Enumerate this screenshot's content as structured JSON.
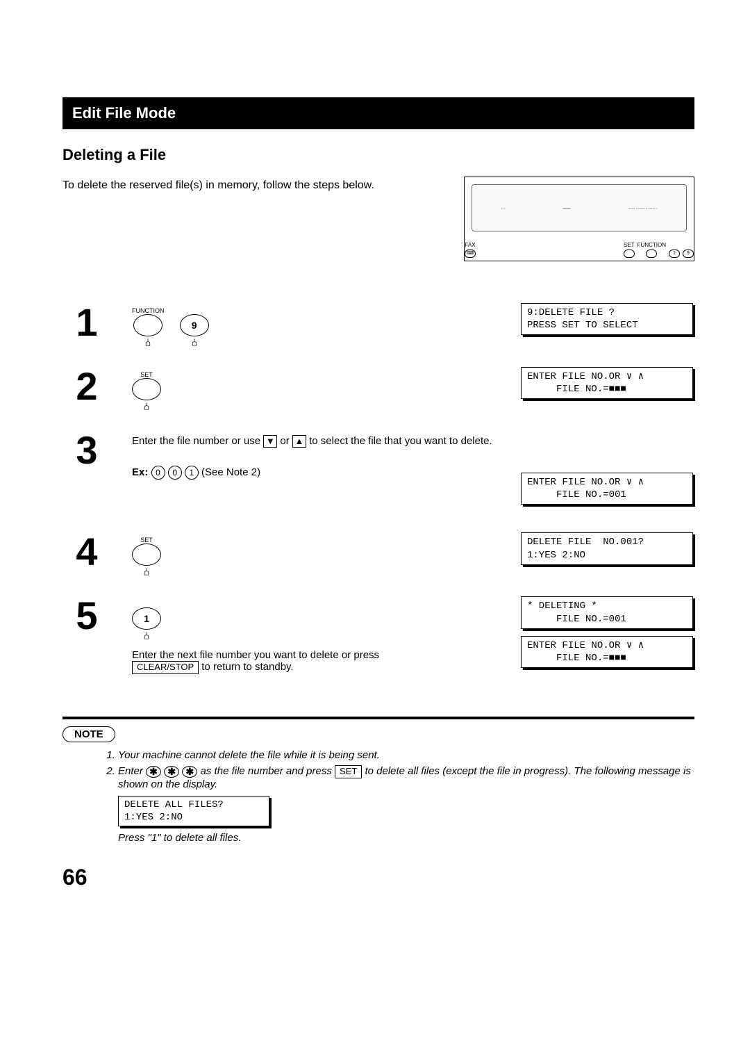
{
  "title_bar": "Edit File Mode",
  "sub_title": "Deleting a File",
  "intro": "To delete the reserved file(s) in memory, follow the steps below.",
  "panel_legend": {
    "fax": "FAX",
    "set": "SET",
    "function": "FUNCTION",
    "one": "1",
    "nine": "9"
  },
  "buttons": {
    "function": "FUNCTION",
    "set": "SET",
    "nine": "9",
    "one": "1"
  },
  "steps": {
    "s1_lcd_line1": "9:DELETE FILE ?",
    "s1_lcd_line2": "PRESS SET TO SELECT",
    "s2_lcd_line1": "ENTER FILE NO.OR ∨ ∧",
    "s2_lcd_line2": "     FILE NO.=■■■",
    "s3_text_a": "Enter the file number or use ",
    "s3_text_b": " or ",
    "s3_text_c": " to select the file that you want to delete.",
    "s3_ex_label": "Ex:",
    "s3_ex_digits": [
      "0",
      "0",
      "1"
    ],
    "s3_ex_note": " (See Note 2)",
    "s3_lcd_line1": "ENTER FILE NO.OR ∨ ∧",
    "s3_lcd_line2": "     FILE NO.=001",
    "s4_lcd_line1": "DELETE FILE  NO.001?",
    "s4_lcd_line2": "1:YES 2:NO",
    "s5_lcd1_line1": "* DELETING *",
    "s5_lcd1_line2": "     FILE NO.=001",
    "s5_lcd2_line1": "ENTER FILE NO.OR ∨ ∧",
    "s5_lcd2_line2": "     FILE NO.=■■■",
    "s5_text_a": "Enter the next file number you want to delete or press ",
    "s5_clear_stop": "CLEAR/STOP",
    "s5_text_b": " to return to standby."
  },
  "note": {
    "label": "NOTE",
    "n1": "Your machine cannot delete the file while it is being sent.",
    "n2_a": "Enter ",
    "n2_b": " as the file number and press ",
    "n2_set": "SET",
    "n2_c": " to delete all files (except the file in progress). The following message is shown on the display.",
    "n2_lcd_line1": "DELETE ALL FILES?",
    "n2_lcd_line2": "1:YES 2:NO",
    "n2_d": "Press \"1\" to delete all files."
  },
  "page_number": "66"
}
